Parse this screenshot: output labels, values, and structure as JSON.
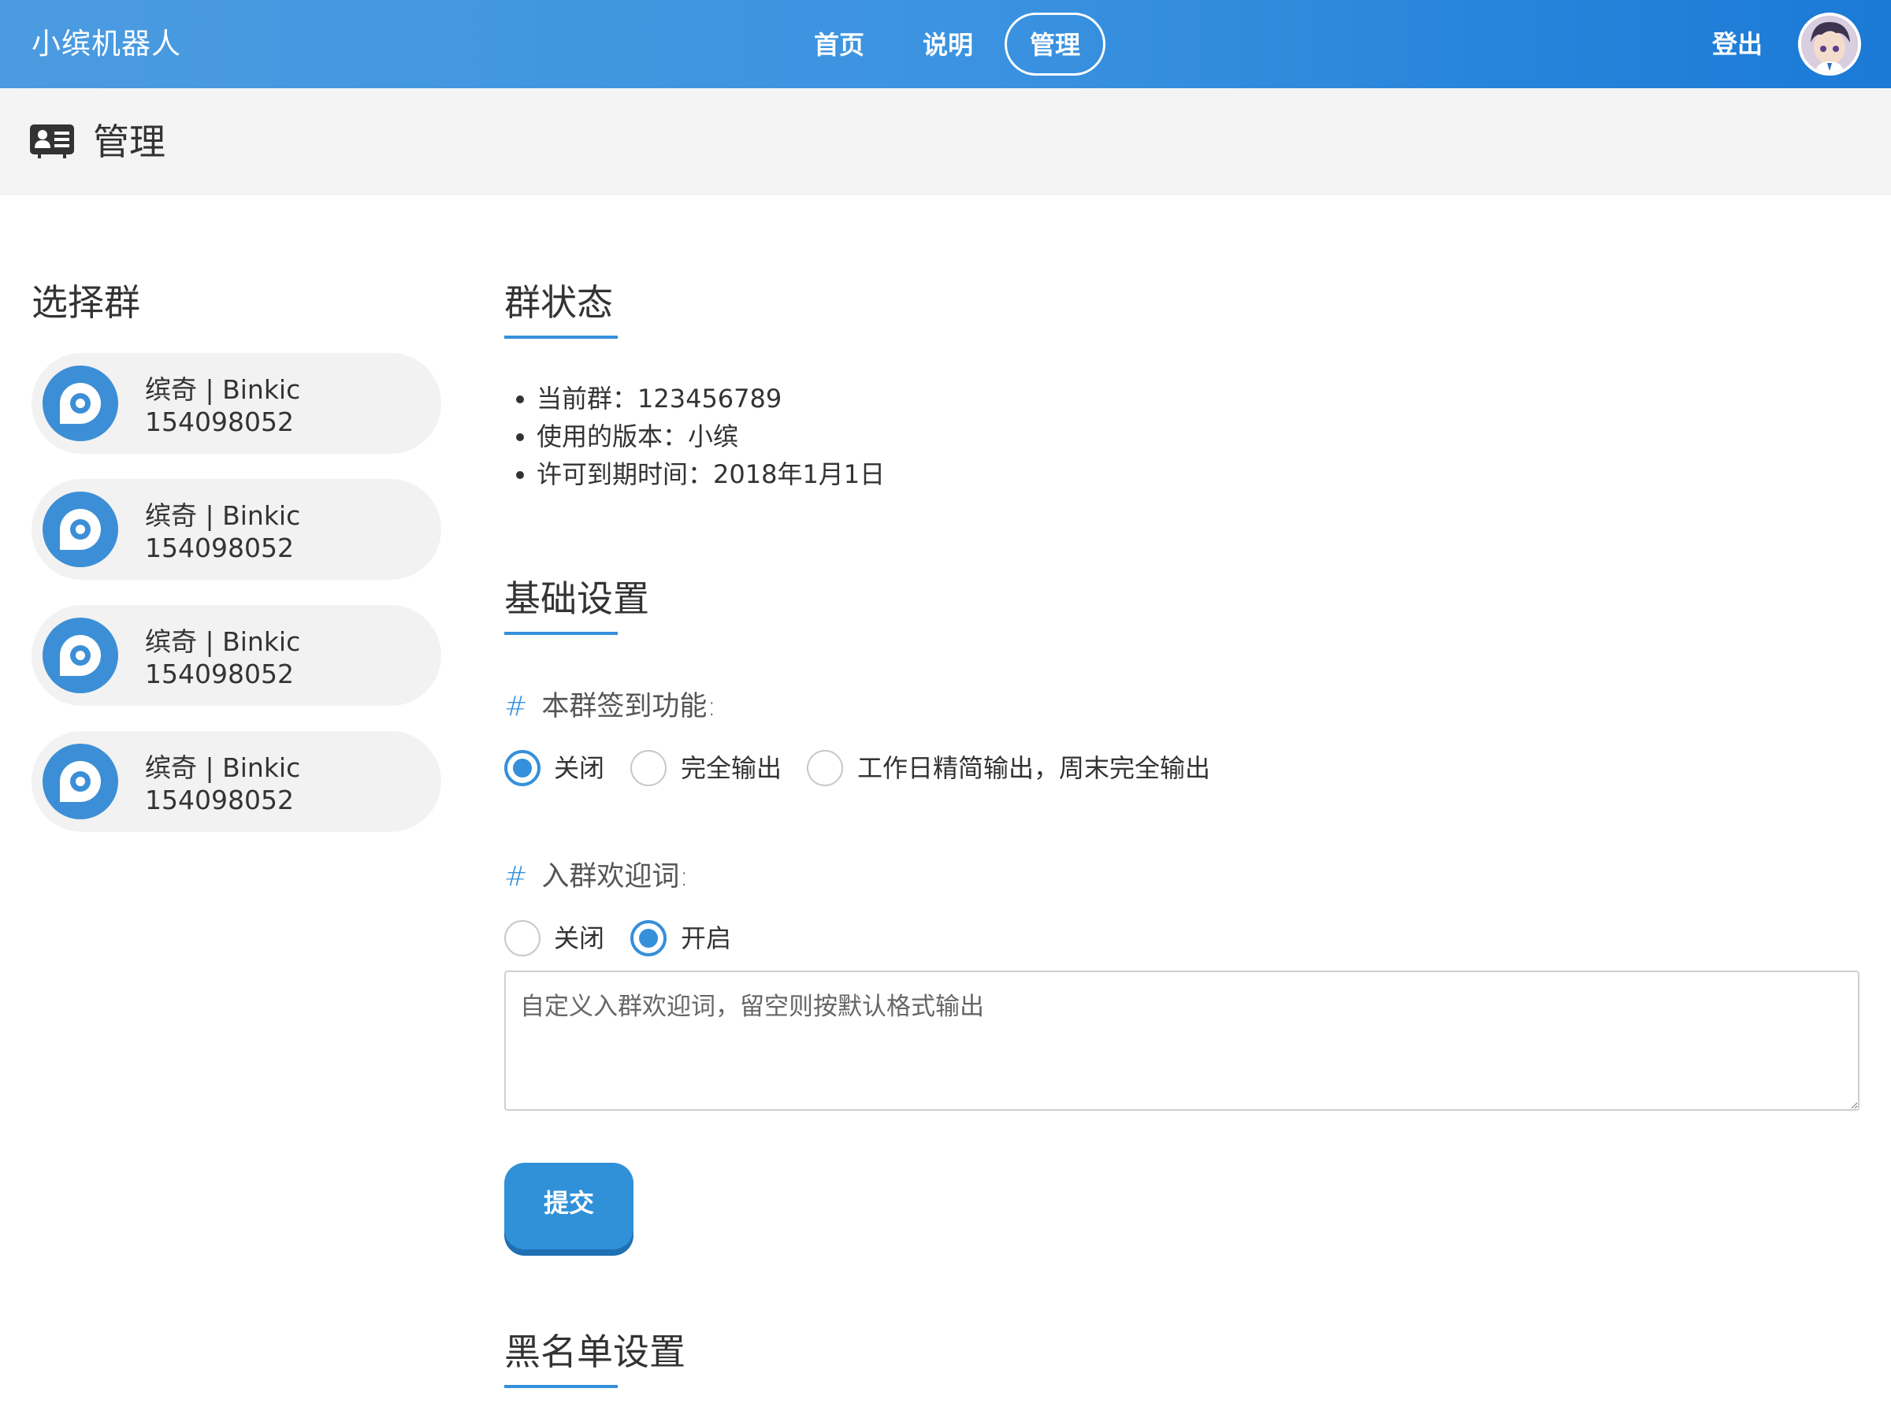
{
  "app": {
    "brand": "小缤机器人"
  },
  "nav": {
    "home": "首页",
    "help": "说明",
    "manage": "管理",
    "logout": "登出"
  },
  "page_header": {
    "title": "管理",
    "icon": "id-card-icon"
  },
  "left": {
    "title": "选择群",
    "groups": [
      {
        "name": "缤奇 | Binkic",
        "id": "154098052"
      },
      {
        "name": "缤奇 | Binkic",
        "id": "154098052"
      },
      {
        "name": "缤奇 | Binkic",
        "id": "154098052"
      },
      {
        "name": "缤奇 | Binkic",
        "id": "154098052"
      }
    ]
  },
  "status": {
    "title": "群状态",
    "items": [
      "当前群：123456789",
      "使用的版本：小缤",
      "许可到期时间：2018年1月1日"
    ]
  },
  "basic": {
    "title": "基础设置",
    "checkin": {
      "hash": "#",
      "label": "本群签到功能:",
      "options": [
        "关闭",
        "完全输出",
        "工作日精简输出，周末完全输出"
      ],
      "selected": "关闭"
    },
    "welcome": {
      "hash": "#",
      "label": "入群欢迎词:",
      "options": [
        "关闭",
        "开启"
      ],
      "selected": "开启",
      "placeholder": "自定义入群欢迎词，留空则按默认格式输出",
      "value": ""
    },
    "submit": "提交"
  },
  "blacklist": {
    "title": "黑名单设置"
  },
  "colors": {
    "accent": "#3590db",
    "nav_gradient_start": "#4b9be0",
    "nav_gradient_end": "#1a7ad6",
    "header_bg": "#f4f4f4",
    "card_bg": "#f2f2f2"
  }
}
